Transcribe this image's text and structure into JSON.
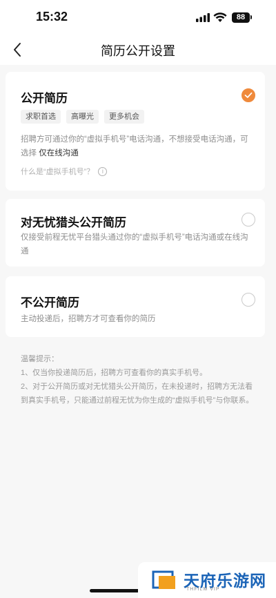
{
  "status_bar": {
    "time": "15:32",
    "battery": "88"
  },
  "nav": {
    "title": "简历公开设置"
  },
  "options": [
    {
      "title": "公开简历",
      "checked": true,
      "tags": [
        "求职首选",
        "高曝光",
        "更多机会"
      ],
      "desc_part1": "招聘方可通过你的“虚拟手机号”电话沟通，不想接受电话沟通，可选择 ",
      "desc_highlight": "仅在线沟通",
      "link": "什么是“虚拟手机号”？"
    },
    {
      "title": "对无忧猎头公开简历",
      "checked": false,
      "desc": "仅接受前程无忧平台猎头通过你的“虚拟手机号”电话沟通或在线沟通"
    },
    {
      "title": "不公开简历",
      "checked": false,
      "desc": "主动投递后，招聘方才可查看你的简历"
    }
  ],
  "tips": {
    "heading": "温馨提示：",
    "items": [
      "1、仅当你投递简历后，招聘方可查看你的真实手机号。",
      "2、对于公开简历或对无忧猎头公开简历，在未投递时，招聘方无法看到真实手机号，只能通过前程无忧为你生成的“虚拟手机号”与你联系。"
    ]
  },
  "watermark": {
    "main": "天府乐游网",
    "sub": "THFILM VIP"
  },
  "colors": {
    "accent": "#ef8a3c",
    "watermark": "#1b64b7"
  },
  "icons": {
    "back": "chevron-left-icon",
    "check": "check-icon",
    "info": "info-icon",
    "signal": "signal-icon",
    "wifi": "wifi-icon",
    "battery": "battery-icon"
  }
}
